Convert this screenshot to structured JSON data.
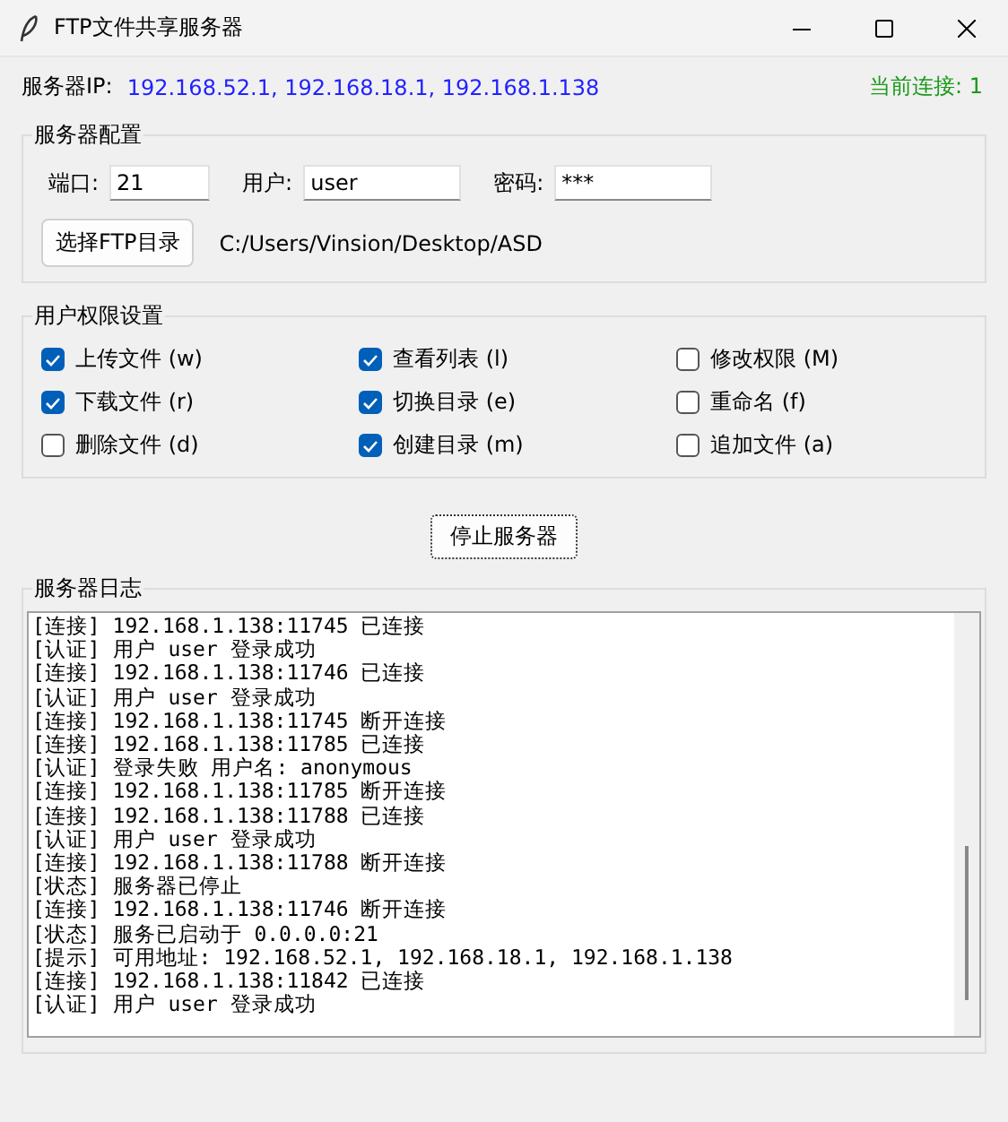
{
  "window": {
    "title": "FTP文件共享服务器"
  },
  "status": {
    "ip_label": "服务器IP:",
    "ip_value": "192.168.52.1, 192.168.18.1, 192.168.1.138",
    "connections": "当前连接: 1"
  },
  "config": {
    "title": "服务器配置",
    "fields": [
      {
        "label": "端口:",
        "value": "21"
      },
      {
        "label": "用户:",
        "value": "user"
      },
      {
        "label": "密码:",
        "value": "***"
      }
    ],
    "dir_button": "选择FTP目录",
    "dir_path": "C:/Users/Vinsion/Desktop/ASD"
  },
  "permissions": {
    "title": "用户权限设置",
    "items": [
      {
        "label": "上传文件 (w)",
        "checked": true
      },
      {
        "label": "查看列表 (l)",
        "checked": true
      },
      {
        "label": "修改权限 (M)",
        "checked": false
      },
      {
        "label": "下载文件 (r)",
        "checked": true
      },
      {
        "label": "切换目录 (e)",
        "checked": true
      },
      {
        "label": "重命名 (f)",
        "checked": false
      },
      {
        "label": "删除文件 (d)",
        "checked": false
      },
      {
        "label": "创建目录 (m)",
        "checked": true
      },
      {
        "label": "追加文件 (a)",
        "checked": false
      }
    ]
  },
  "stop_button": "停止服务器",
  "log": {
    "title": "服务器日志",
    "lines": [
      "[连接] 192.168.1.138:11745 已连接",
      "[认证] 用户 user 登录成功",
      "[连接] 192.168.1.138:11746 已连接",
      "[认证] 用户 user 登录成功",
      "[连接] 192.168.1.138:11745 断开连接",
      "[连接] 192.168.1.138:11785 已连接",
      "[认证] 登录失败 用户名: anonymous",
      "[连接] 192.168.1.138:11785 断开连接",
      "[连接] 192.168.1.138:11788 已连接",
      "[认证] 用户 user 登录成功",
      "[连接] 192.168.1.138:11788 断开连接",
      "[状态] 服务器已停止",
      "[连接] 192.168.1.138:11746 断开连接",
      "[状态] 服务已启动于 0.0.0.0:21",
      "[提示] 可用地址: 192.168.52.1, 192.168.18.1, 192.168.1.138",
      "[连接] 192.168.1.138:11842 已连接",
      "[认证] 用户 user 登录成功"
    ]
  }
}
